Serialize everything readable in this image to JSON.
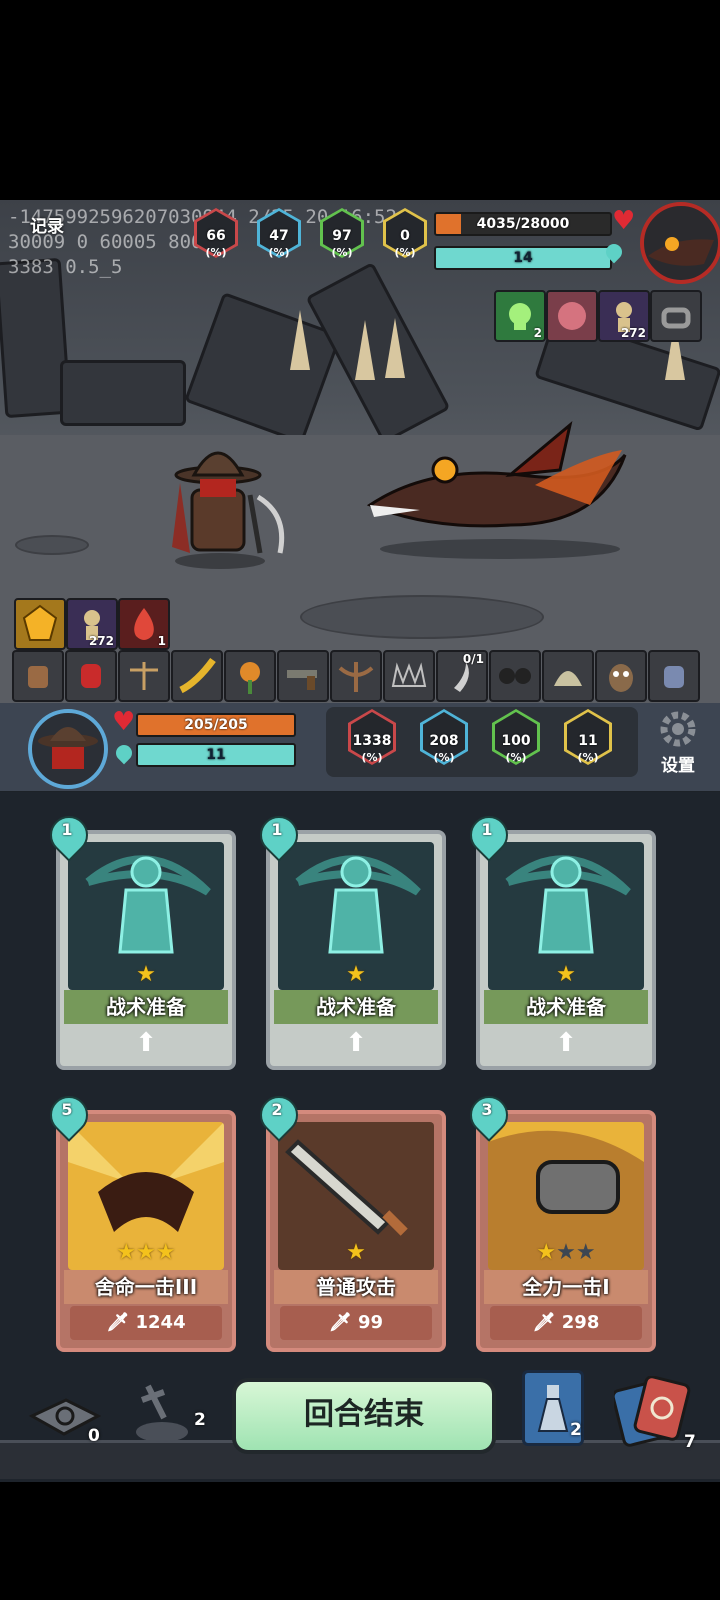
{
  "debug": {
    "line1": "-1475992596207030944 2/25 20:16:52",
    "line2": "30009 0 60005 80006",
    "line3": "3383 0.5_5"
  },
  "record_label": "记录",
  "enemy": {
    "hp": "4035/28000",
    "hp_fraction": 0.144,
    "energy": "14",
    "stats": [
      {
        "value": "66",
        "unit": "(%)",
        "icon": "attack-icon",
        "color": "#c9484a"
      },
      {
        "value": "47",
        "unit": "(%)",
        "icon": "crit-icon",
        "color": "#4fb4d8"
      },
      {
        "value": "97",
        "unit": "(%)",
        "icon": "defense-icon",
        "color": "#62c24e"
      },
      {
        "value": "0",
        "unit": "(%)",
        "icon": "dodge-icon",
        "color": "#e0c24a"
      }
    ],
    "buffs": [
      {
        "icon": "poison-skull-icon",
        "count": "2"
      },
      {
        "icon": "monster-face-icon",
        "count": ""
      },
      {
        "icon": "voodoo-doll-icon",
        "count": "272"
      },
      {
        "icon": "shackle-icon",
        "count": ""
      }
    ]
  },
  "player_buffs": [
    {
      "icon": "gem-icon",
      "count": ""
    },
    {
      "icon": "voodoo-doll-icon",
      "count": "272"
    },
    {
      "icon": "fire-drop-icon",
      "count": "1"
    }
  ],
  "equipment": [
    {
      "icon": "claw-gauntlet-icon",
      "count": ""
    },
    {
      "icon": "red-glove-icon",
      "count": ""
    },
    {
      "icon": "scales-icon",
      "count": ""
    },
    {
      "icon": "golden-horn-icon",
      "count": ""
    },
    {
      "icon": "flower-icon",
      "count": ""
    },
    {
      "icon": "pistol-icon",
      "count": ""
    },
    {
      "icon": "crossbow-icon",
      "count": ""
    },
    {
      "icon": "trap-icon",
      "count": ""
    },
    {
      "icon": "blade-icon",
      "count": "0/1"
    },
    {
      "icon": "goggles-icon",
      "count": ""
    },
    {
      "icon": "helmet-icon",
      "count": ""
    },
    {
      "icon": "owl-icon",
      "count": ""
    },
    {
      "icon": "magic-glove-icon",
      "count": ""
    }
  ],
  "player": {
    "hp": "205/205",
    "energy": "11",
    "stats": [
      {
        "value": "1338",
        "unit": "(%)",
        "icon": "attack-icon",
        "color": "#c9484a"
      },
      {
        "value": "208",
        "unit": "(%)",
        "icon": "crit-icon",
        "color": "#4fb4d8"
      },
      {
        "value": "100",
        "unit": "(%)",
        "icon": "defense-icon",
        "color": "#62c24e"
      },
      {
        "value": "11",
        "unit": "(%)",
        "icon": "dodge-icon",
        "color": "#e0c24a"
      }
    ],
    "settings_label": "设置"
  },
  "cards": [
    {
      "name": "战术准备",
      "cost": "1",
      "stars": 1,
      "max_stars": 1,
      "kind": "skill",
      "damage": ""
    },
    {
      "name": "战术准备",
      "cost": "1",
      "stars": 1,
      "max_stars": 1,
      "kind": "skill",
      "damage": ""
    },
    {
      "name": "战术准备",
      "cost": "1",
      "stars": 1,
      "max_stars": 1,
      "kind": "skill",
      "damage": ""
    },
    {
      "name": "舍命一击III",
      "cost": "5",
      "stars": 3,
      "max_stars": 3,
      "kind": "attack",
      "damage": "1244"
    },
    {
      "name": "普通攻击",
      "cost": "2",
      "stars": 1,
      "max_stars": 1,
      "kind": "attack",
      "damage": "99"
    },
    {
      "name": "全力一击I",
      "cost": "3",
      "stars": 1,
      "max_stars": 3,
      "kind": "attack",
      "damage": "298"
    }
  ],
  "bottom": {
    "discard_count": "0",
    "grave_count": "2",
    "end_turn_label": "回合结束",
    "potion_count": "2",
    "deck_count": "7"
  }
}
